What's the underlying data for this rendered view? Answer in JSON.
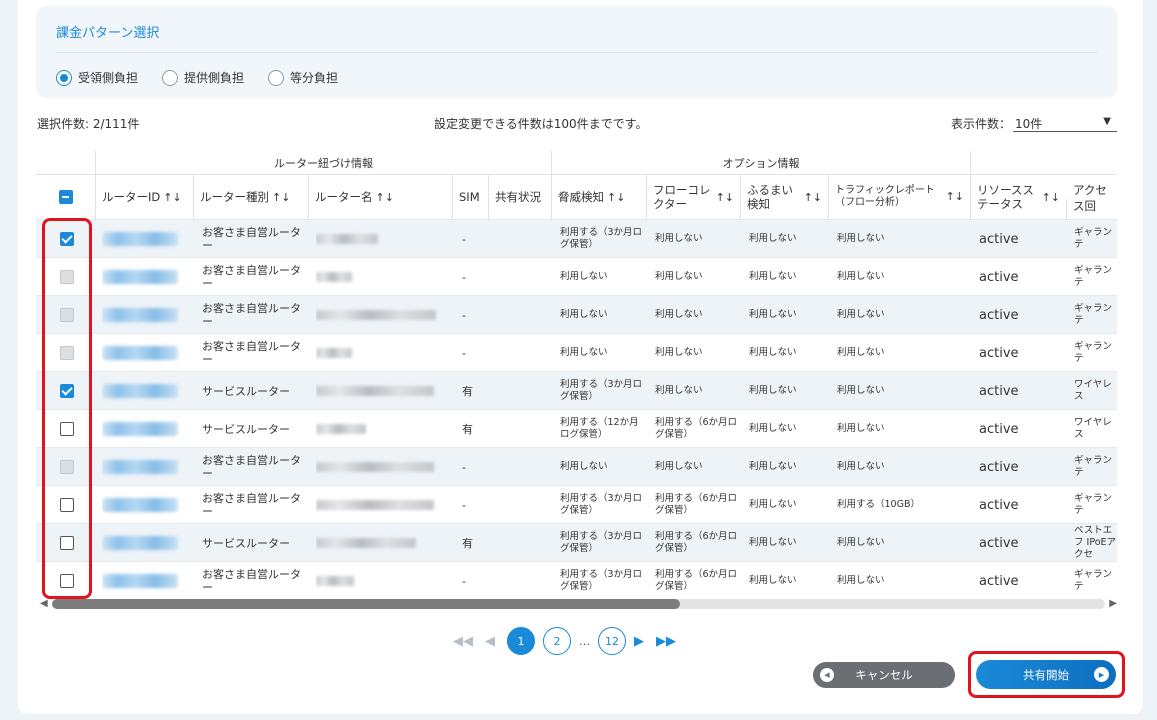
{
  "billing": {
    "title": "課金パターン選択",
    "options": [
      {
        "label": "受領側負担",
        "selected": true
      },
      {
        "label": "提供側負担",
        "selected": false
      },
      {
        "label": "等分負担",
        "selected": false
      }
    ]
  },
  "toolbar": {
    "selection_count": "選択件数: 2/111件",
    "notice": "設定変更できる件数は100件までです。",
    "perpage_label": "表示件数：",
    "perpage_value": "10件"
  },
  "table": {
    "group_headers": {
      "router": "ルーター紐づけ情報",
      "option": "オプション情報"
    },
    "columns": {
      "router_id": "ルーターID",
      "router_type": "ルーター種別",
      "router_name": "ルーター名",
      "sim": "SIM",
      "share_status": "共有状況",
      "threat": "脅威検知",
      "flow_col_1": "フローコレ",
      "flow_col_2": "クター",
      "furumai_1": "ふるまい",
      "furumai_2": "検知",
      "traffic_1": "トラフィックレポート",
      "traffic_2": "（フロー分析）",
      "resource_1": "リソースス",
      "resource_2": "テータス",
      "access": "アクセス回"
    },
    "sort_icon": "↑↓",
    "rows": [
      {
        "checked": "on",
        "type": "お客さま自営ルーター",
        "sim": "-",
        "threat": "利用する（3か月ログ保管）",
        "flow": "利用しない",
        "furumai": "利用しない",
        "traffic": "利用しない",
        "status": "active",
        "access": "ギャランテ"
      },
      {
        "checked": "dis",
        "type": "お客さま自営ルーター",
        "sim": "-",
        "threat": "利用しない",
        "flow": "利用しない",
        "furumai": "利用しない",
        "traffic": "利用しない",
        "status": "active",
        "access": "ギャランテ"
      },
      {
        "checked": "dis",
        "type": "お客さま自営ルーター",
        "sim": "-",
        "threat": "利用しない",
        "flow": "利用しない",
        "furumai": "利用しない",
        "traffic": "利用しない",
        "status": "active",
        "access": "ギャランテ"
      },
      {
        "checked": "dis",
        "type": "お客さま自営ルーター",
        "sim": "-",
        "threat": "利用しない",
        "flow": "利用しない",
        "furumai": "利用しない",
        "traffic": "利用しない",
        "status": "active",
        "access": "ギャランテ"
      },
      {
        "checked": "on",
        "type": "サービスルーター",
        "sim": "有",
        "threat": "利用する（3か月ログ保管）",
        "flow": "利用しない",
        "furumai": "利用しない",
        "traffic": "利用しない",
        "status": "active",
        "access": "ワイヤレス"
      },
      {
        "checked": "off",
        "type": "サービスルーター",
        "sim": "有",
        "threat": "利用する（12か月ログ保管）",
        "flow": "利用する（6か月ログ保管）",
        "furumai": "利用しない",
        "traffic": "利用しない",
        "status": "active",
        "access": "ワイヤレス"
      },
      {
        "checked": "dis",
        "type": "お客さま自営ルーター",
        "sim": "-",
        "threat": "利用しない",
        "flow": "利用しない",
        "furumai": "利用しない",
        "traffic": "利用しない",
        "status": "active",
        "access": "ギャランテ"
      },
      {
        "checked": "off",
        "type": "お客さま自営ルーター",
        "sim": "-",
        "threat": "利用する（3か月ログ保管）",
        "flow": "利用する（6か月ログ保管）",
        "furumai": "利用しない",
        "traffic": "利用する（10GB）",
        "status": "active",
        "access": "ギャランテ"
      },
      {
        "checked": "off",
        "type": "サービスルーター",
        "sim": "有",
        "threat": "利用する（3か月ログ保管）",
        "flow": "利用する（6か月ログ保管）",
        "furumai": "利用しない",
        "traffic": "利用しない",
        "status": "active",
        "access": "ベストエフ IPoEアクセ"
      },
      {
        "checked": "off",
        "type": "お客さま自営ルーター",
        "sim": "-",
        "threat": "利用する（3か月ログ保管）",
        "flow": "利用する（6か月ログ保管）",
        "furumai": "利用しない",
        "traffic": "利用しない",
        "status": "active",
        "access": "ギャランテ"
      }
    ]
  },
  "pagination": {
    "pages": [
      "1",
      "2",
      "12"
    ],
    "ellipsis": "…",
    "current": "1"
  },
  "actions": {
    "cancel_label": "キャンセル",
    "share_label": "共有開始"
  }
}
